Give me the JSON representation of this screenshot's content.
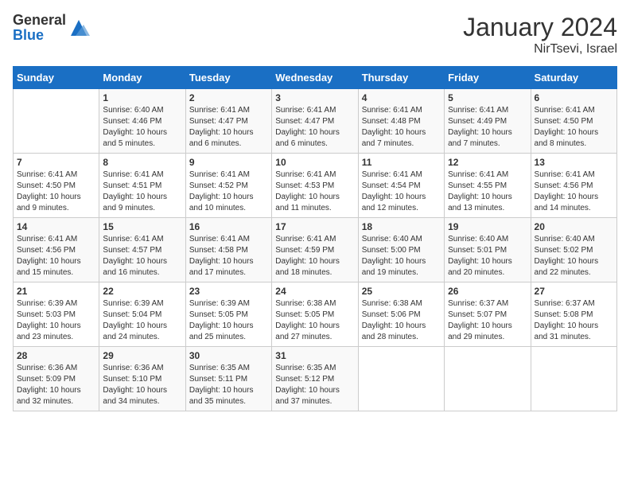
{
  "header": {
    "logo_general": "General",
    "logo_blue": "Blue",
    "month": "January 2024",
    "location": "NirTsevi, Israel"
  },
  "weekdays": [
    "Sunday",
    "Monday",
    "Tuesday",
    "Wednesday",
    "Thursday",
    "Friday",
    "Saturday"
  ],
  "weeks": [
    [
      {
        "day": "",
        "sunrise": "",
        "sunset": "",
        "daylight": ""
      },
      {
        "day": "1",
        "sunrise": "Sunrise: 6:40 AM",
        "sunset": "Sunset: 4:46 PM",
        "daylight": "Daylight: 10 hours and 5 minutes."
      },
      {
        "day": "2",
        "sunrise": "Sunrise: 6:41 AM",
        "sunset": "Sunset: 4:47 PM",
        "daylight": "Daylight: 10 hours and 6 minutes."
      },
      {
        "day": "3",
        "sunrise": "Sunrise: 6:41 AM",
        "sunset": "Sunset: 4:47 PM",
        "daylight": "Daylight: 10 hours and 6 minutes."
      },
      {
        "day": "4",
        "sunrise": "Sunrise: 6:41 AM",
        "sunset": "Sunset: 4:48 PM",
        "daylight": "Daylight: 10 hours and 7 minutes."
      },
      {
        "day": "5",
        "sunrise": "Sunrise: 6:41 AM",
        "sunset": "Sunset: 4:49 PM",
        "daylight": "Daylight: 10 hours and 7 minutes."
      },
      {
        "day": "6",
        "sunrise": "Sunrise: 6:41 AM",
        "sunset": "Sunset: 4:50 PM",
        "daylight": "Daylight: 10 hours and 8 minutes."
      }
    ],
    [
      {
        "day": "7",
        "sunrise": "Sunrise: 6:41 AM",
        "sunset": "Sunset: 4:50 PM",
        "daylight": "Daylight: 10 hours and 9 minutes."
      },
      {
        "day": "8",
        "sunrise": "Sunrise: 6:41 AM",
        "sunset": "Sunset: 4:51 PM",
        "daylight": "Daylight: 10 hours and 9 minutes."
      },
      {
        "day": "9",
        "sunrise": "Sunrise: 6:41 AM",
        "sunset": "Sunset: 4:52 PM",
        "daylight": "Daylight: 10 hours and 10 minutes."
      },
      {
        "day": "10",
        "sunrise": "Sunrise: 6:41 AM",
        "sunset": "Sunset: 4:53 PM",
        "daylight": "Daylight: 10 hours and 11 minutes."
      },
      {
        "day": "11",
        "sunrise": "Sunrise: 6:41 AM",
        "sunset": "Sunset: 4:54 PM",
        "daylight": "Daylight: 10 hours and 12 minutes."
      },
      {
        "day": "12",
        "sunrise": "Sunrise: 6:41 AM",
        "sunset": "Sunset: 4:55 PM",
        "daylight": "Daylight: 10 hours and 13 minutes."
      },
      {
        "day": "13",
        "sunrise": "Sunrise: 6:41 AM",
        "sunset": "Sunset: 4:56 PM",
        "daylight": "Daylight: 10 hours and 14 minutes."
      }
    ],
    [
      {
        "day": "14",
        "sunrise": "Sunrise: 6:41 AM",
        "sunset": "Sunset: 4:56 PM",
        "daylight": "Daylight: 10 hours and 15 minutes."
      },
      {
        "day": "15",
        "sunrise": "Sunrise: 6:41 AM",
        "sunset": "Sunset: 4:57 PM",
        "daylight": "Daylight: 10 hours and 16 minutes."
      },
      {
        "day": "16",
        "sunrise": "Sunrise: 6:41 AM",
        "sunset": "Sunset: 4:58 PM",
        "daylight": "Daylight: 10 hours and 17 minutes."
      },
      {
        "day": "17",
        "sunrise": "Sunrise: 6:41 AM",
        "sunset": "Sunset: 4:59 PM",
        "daylight": "Daylight: 10 hours and 18 minutes."
      },
      {
        "day": "18",
        "sunrise": "Sunrise: 6:40 AM",
        "sunset": "Sunset: 5:00 PM",
        "daylight": "Daylight: 10 hours and 19 minutes."
      },
      {
        "day": "19",
        "sunrise": "Sunrise: 6:40 AM",
        "sunset": "Sunset: 5:01 PM",
        "daylight": "Daylight: 10 hours and 20 minutes."
      },
      {
        "day": "20",
        "sunrise": "Sunrise: 6:40 AM",
        "sunset": "Sunset: 5:02 PM",
        "daylight": "Daylight: 10 hours and 22 minutes."
      }
    ],
    [
      {
        "day": "21",
        "sunrise": "Sunrise: 6:39 AM",
        "sunset": "Sunset: 5:03 PM",
        "daylight": "Daylight: 10 hours and 23 minutes."
      },
      {
        "day": "22",
        "sunrise": "Sunrise: 6:39 AM",
        "sunset": "Sunset: 5:04 PM",
        "daylight": "Daylight: 10 hours and 24 minutes."
      },
      {
        "day": "23",
        "sunrise": "Sunrise: 6:39 AM",
        "sunset": "Sunset: 5:05 PM",
        "daylight": "Daylight: 10 hours and 25 minutes."
      },
      {
        "day": "24",
        "sunrise": "Sunrise: 6:38 AM",
        "sunset": "Sunset: 5:05 PM",
        "daylight": "Daylight: 10 hours and 27 minutes."
      },
      {
        "day": "25",
        "sunrise": "Sunrise: 6:38 AM",
        "sunset": "Sunset: 5:06 PM",
        "daylight": "Daylight: 10 hours and 28 minutes."
      },
      {
        "day": "26",
        "sunrise": "Sunrise: 6:37 AM",
        "sunset": "Sunset: 5:07 PM",
        "daylight": "Daylight: 10 hours and 29 minutes."
      },
      {
        "day": "27",
        "sunrise": "Sunrise: 6:37 AM",
        "sunset": "Sunset: 5:08 PM",
        "daylight": "Daylight: 10 hours and 31 minutes."
      }
    ],
    [
      {
        "day": "28",
        "sunrise": "Sunrise: 6:36 AM",
        "sunset": "Sunset: 5:09 PM",
        "daylight": "Daylight: 10 hours and 32 minutes."
      },
      {
        "day": "29",
        "sunrise": "Sunrise: 6:36 AM",
        "sunset": "Sunset: 5:10 PM",
        "daylight": "Daylight: 10 hours and 34 minutes."
      },
      {
        "day": "30",
        "sunrise": "Sunrise: 6:35 AM",
        "sunset": "Sunset: 5:11 PM",
        "daylight": "Daylight: 10 hours and 35 minutes."
      },
      {
        "day": "31",
        "sunrise": "Sunrise: 6:35 AM",
        "sunset": "Sunset: 5:12 PM",
        "daylight": "Daylight: 10 hours and 37 minutes."
      },
      {
        "day": "",
        "sunrise": "",
        "sunset": "",
        "daylight": ""
      },
      {
        "day": "",
        "sunrise": "",
        "sunset": "",
        "daylight": ""
      },
      {
        "day": "",
        "sunrise": "",
        "sunset": "",
        "daylight": ""
      }
    ]
  ]
}
